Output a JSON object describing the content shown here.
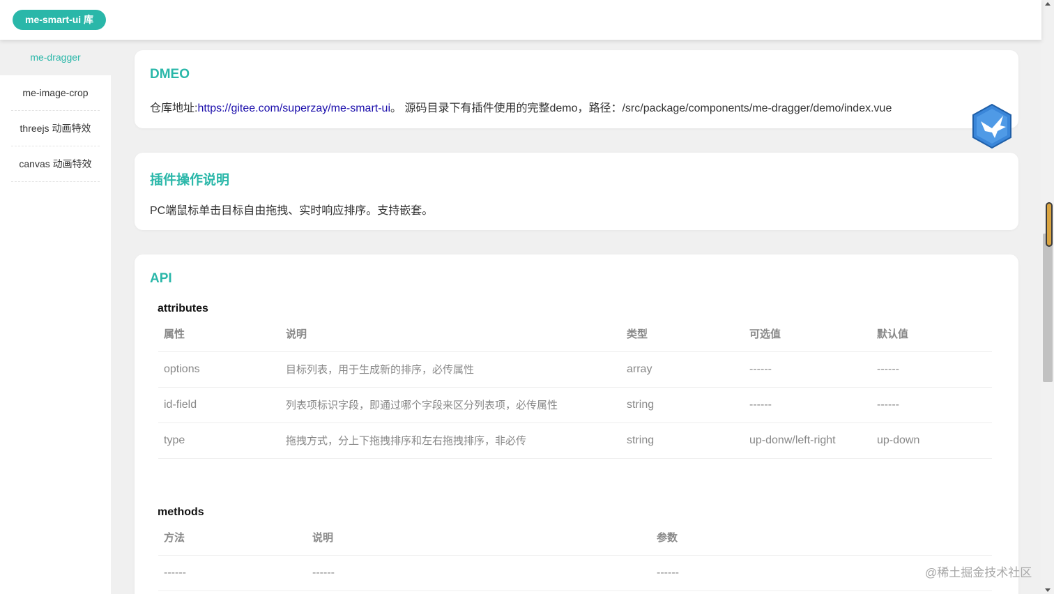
{
  "header": {
    "logo_label": "me-smart-ui 库"
  },
  "sidebar": {
    "items": [
      {
        "label": "me-dragger"
      },
      {
        "label": "me-image-crop"
      },
      {
        "label": "threejs 动画特效"
      },
      {
        "label": "canvas 动画特效"
      }
    ]
  },
  "demo": {
    "title": "DMEO",
    "repo_prefix": "仓库地址:",
    "repo_url": "https://gitee.com/superzay/me-smart-ui",
    "repo_suffix": "。 源码目录下有插件使用的完整demo，路径：/src/package/components/me-dragger/demo/index.vue"
  },
  "usage": {
    "title": "插件操作说明",
    "text": "PC端鼠标单击目标自由拖拽、实时响应排序。支持嵌套。"
  },
  "api": {
    "title": "API",
    "attributes": {
      "title": "attributes",
      "headers": [
        "属性",
        "说明",
        "类型",
        "可选值",
        "默认值"
      ],
      "rows": [
        [
          "options",
          "目标列表，用于生成新的排序，必传属性",
          "array",
          "------",
          "------"
        ],
        [
          "id-field",
          "列表项标识字段，即通过哪个字段来区分列表项，必传属性",
          "string",
          "------",
          "------"
        ],
        [
          "type",
          "拖拽方式，分上下拖拽排序和左右拖拽排序，非必传",
          "string",
          "up-donw/left-right",
          "up-down"
        ]
      ]
    },
    "methods": {
      "title": "methods",
      "headers": [
        "方法",
        "说明",
        "参数"
      ],
      "rows": [
        [
          "------",
          "------",
          "------"
        ]
      ]
    }
  },
  "watermark": "@稀土掘金技术社区",
  "colors": {
    "accent": "#2ab7a9",
    "link": "#1a0dab",
    "background": "#f0f0f0"
  },
  "icons": {
    "floating": "bird-icon"
  }
}
